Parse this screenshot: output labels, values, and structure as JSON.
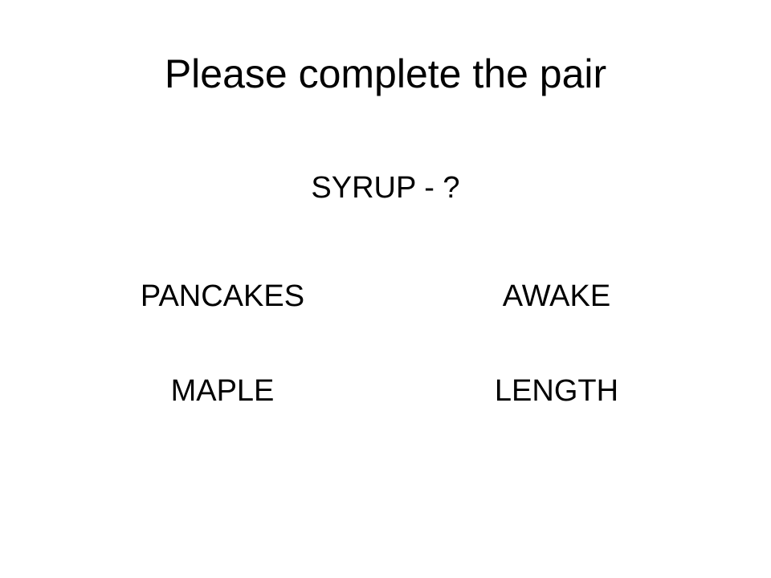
{
  "title": "Please complete the pair",
  "prompt": "SYRUP - ?",
  "options": [
    {
      "label": "PANCAKES"
    },
    {
      "label": "AWAKE"
    },
    {
      "label": "MAPLE"
    },
    {
      "label": "LENGTH"
    }
  ],
  "colors": {
    "background": "#ffffff",
    "text": "#000000"
  }
}
